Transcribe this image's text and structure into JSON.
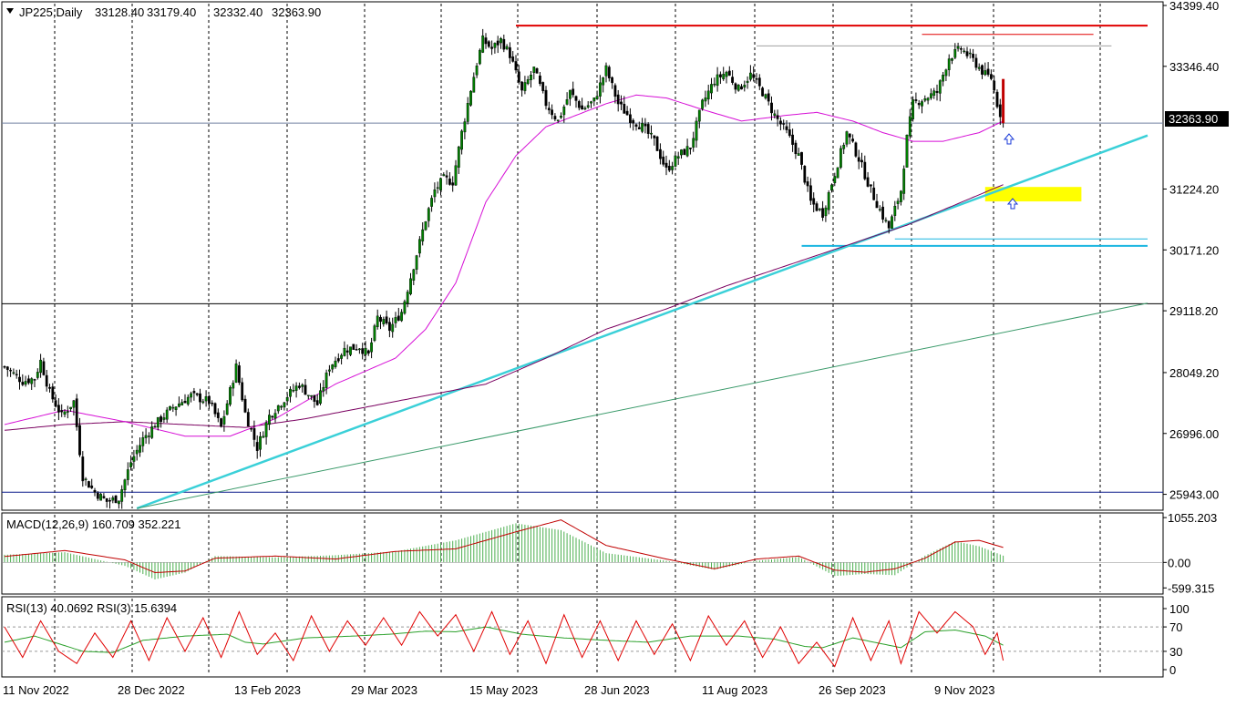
{
  "colors": {
    "bull_candle": "#008000",
    "bear_candle": "#000000",
    "ma_fast": "#d60fd6",
    "ma_slow": "#7a0060",
    "trendline": "#3ad0d8",
    "trendline_long": "#3a9a6a",
    "resistance": "#e00000",
    "support": "#19b5e0",
    "zone": "#ffff00",
    "macd_hist": "#4caf50",
    "macd_signal": "#c00000",
    "rsi_fast": "#e00000",
    "rsi_slow": "#2aa02a",
    "arrow": "#1a3ad8"
  },
  "chart_data": [
    {
      "type": "candlestick",
      "title": "JP225,Daily",
      "ohlc_readout": [
        "33128.40",
        "33179.40",
        "32332.40",
        "32363.90"
      ],
      "x_tick_labels": [
        "11 Nov 2022",
        "28 Dec 2022",
        "13 Feb 2023",
        "29 Mar 2023",
        "15 May 2023",
        "28 Jun 2023",
        "11 Aug 2023",
        "26 Sep 2023",
        "9 Nov 2023"
      ],
      "y_tick_labels": [
        "34399.40",
        "33346.40",
        "31224.20",
        "30171.20",
        "29118.20",
        "28049.20",
        "26996.00",
        "25943.00"
      ],
      "ylim": [
        25700,
        34399.4
      ],
      "current_price": "32363.90",
      "horizontal_levels": [
        34050,
        33700,
        29240,
        25980,
        30360,
        30240
      ],
      "closes_anchor": [
        [
          0,
          28150
        ],
        [
          6,
          27900
        ],
        [
          10,
          27950
        ],
        [
          12,
          28250
        ],
        [
          15,
          27700
        ],
        [
          19,
          27300
        ],
        [
          23,
          27550
        ],
        [
          26,
          26250
        ],
        [
          30,
          25980
        ],
        [
          34,
          25820
        ],
        [
          38,
          25880
        ],
        [
          42,
          26500
        ],
        [
          46,
          26900
        ],
        [
          50,
          27150
        ],
        [
          56,
          27450
        ],
        [
          62,
          27650
        ],
        [
          68,
          27550
        ],
        [
          72,
          27100
        ],
        [
          77,
          28150
        ],
        [
          80,
          27350
        ],
        [
          84,
          26750
        ],
        [
          88,
          27300
        ],
        [
          94,
          27650
        ],
        [
          98,
          27850
        ],
        [
          104,
          27500
        ],
        [
          108,
          28150
        ],
        [
          113,
          28450
        ],
        [
          118,
          28500
        ],
        [
          121,
          28350
        ],
        [
          124,
          29000
        ],
        [
          128,
          28800
        ],
        [
          132,
          29100
        ],
        [
          136,
          29900
        ],
        [
          140,
          30700
        ],
        [
          143,
          31200
        ],
        [
          146,
          31400
        ],
        [
          149,
          31350
        ],
        [
          152,
          32200
        ],
        [
          155,
          32950
        ],
        [
          157,
          33400
        ],
        [
          159,
          33800
        ],
        [
          162,
          33650
        ],
        [
          165,
          33800
        ],
        [
          168,
          33550
        ],
        [
          172,
          32900
        ],
        [
          176,
          33300
        ],
        [
          180,
          32700
        ],
        [
          184,
          32400
        ],
        [
          188,
          32900
        ],
        [
          192,
          32600
        ],
        [
          196,
          32750
        ],
        [
          200,
          33300
        ],
        [
          204,
          32700
        ],
        [
          208,
          32450
        ],
        [
          212,
          32300
        ],
        [
          216,
          32050
        ],
        [
          220,
          31550
        ],
        [
          224,
          31800
        ],
        [
          228,
          31950
        ],
        [
          232,
          32700
        ],
        [
          236,
          33100
        ],
        [
          240,
          33250
        ],
        [
          244,
          32950
        ],
        [
          248,
          33200
        ],
        [
          252,
          32900
        ],
        [
          256,
          32500
        ],
        [
          260,
          32200
        ],
        [
          264,
          31800
        ],
        [
          268,
          31000
        ],
        [
          272,
          30800
        ],
        [
          276,
          31500
        ],
        [
          280,
          32200
        ],
        [
          284,
          31750
        ],
        [
          288,
          31200
        ],
        [
          292,
          30750
        ],
        [
          294,
          30550
        ],
        [
          298,
          31200
        ],
        [
          300,
          32100
        ],
        [
          302,
          32700
        ],
        [
          306,
          32800
        ],
        [
          310,
          32900
        ],
        [
          314,
          33500
        ],
        [
          318,
          33650
        ],
        [
          322,
          33450
        ],
        [
          326,
          33200
        ],
        [
          328,
          33150
        ],
        [
          330,
          32700
        ],
        [
          332,
          32364
        ]
      ],
      "ma_fast_anchor": [
        [
          0,
          27150
        ],
        [
          20,
          27400
        ],
        [
          40,
          27200
        ],
        [
          60,
          26950
        ],
        [
          75,
          26950
        ],
        [
          90,
          27250
        ],
        [
          110,
          27850
        ],
        [
          130,
          28300
        ],
        [
          140,
          28800
        ],
        [
          150,
          29600
        ],
        [
          160,
          31000
        ],
        [
          170,
          31800
        ],
        [
          180,
          32300
        ],
        [
          190,
          32500
        ],
        [
          200,
          32700
        ],
        [
          210,
          32850
        ],
        [
          220,
          32800
        ],
        [
          232,
          32600
        ],
        [
          245,
          32400
        ],
        [
          260,
          32500
        ],
        [
          270,
          32550
        ],
        [
          282,
          32400
        ],
        [
          292,
          32200
        ],
        [
          302,
          32050
        ],
        [
          312,
          32050
        ],
        [
          324,
          32200
        ],
        [
          332,
          32400
        ]
      ],
      "ma_slow_anchor": [
        [
          0,
          27050
        ],
        [
          20,
          27150
        ],
        [
          40,
          27200
        ],
        [
          60,
          27150
        ],
        [
          80,
          27100
        ],
        [
          100,
          27250
        ],
        [
          120,
          27450
        ],
        [
          140,
          27650
        ],
        [
          160,
          27850
        ],
        [
          180,
          28300
        ],
        [
          200,
          28800
        ],
        [
          220,
          29150
        ],
        [
          240,
          29550
        ],
        [
          260,
          29900
        ],
        [
          280,
          30250
        ],
        [
          300,
          30600
        ],
        [
          316,
          30950
        ],
        [
          332,
          31300
        ]
      ],
      "trend_lines": [
        {
          "from": [
            44,
            25700
          ],
          "to": [
            380,
            32150
          ]
        },
        {
          "from": [
            44,
            25700
          ],
          "to": [
            380,
            29250
          ]
        }
      ],
      "resistance_segments": [
        {
          "value": 34050,
          "from": 170,
          "to": 380
        },
        {
          "value": 33900,
          "from": 305,
          "to": 362
        },
        {
          "value": 33700,
          "from": 250,
          "to": 368
        }
      ],
      "support_segments": [
        {
          "value": 30360,
          "from": 296,
          "to": 380
        },
        {
          "value": 30240,
          "from": 265,
          "to": 380
        }
      ],
      "zone": {
        "x_from": 326,
        "x_to": 358,
        "y_from": 31010,
        "y_to": 31260
      }
    },
    {
      "type": "bar",
      "title": "MACD(12,26,9) 160.709 352.221",
      "y_tick_labels": [
        "1055.203",
        "0.00",
        "-599.315"
      ],
      "ylim": [
        -700,
        1100
      ],
      "hist_anchor": [
        [
          0,
          180
        ],
        [
          20,
          240
        ],
        [
          40,
          -80
        ],
        [
          50,
          -400
        ],
        [
          60,
          -240
        ],
        [
          70,
          150
        ],
        [
          90,
          120
        ],
        [
          110,
          170
        ],
        [
          130,
          260
        ],
        [
          150,
          520
        ],
        [
          170,
          920
        ],
        [
          185,
          760
        ],
        [
          200,
          220
        ],
        [
          220,
          40
        ],
        [
          236,
          -170
        ],
        [
          250,
          40
        ],
        [
          264,
          130
        ],
        [
          276,
          -320
        ],
        [
          286,
          -270
        ],
        [
          296,
          -300
        ],
        [
          306,
          160
        ],
        [
          316,
          500
        ],
        [
          324,
          380
        ],
        [
          332,
          160
        ]
      ],
      "signal_anchor": [
        [
          0,
          140
        ],
        [
          20,
          280
        ],
        [
          40,
          60
        ],
        [
          50,
          -240
        ],
        [
          60,
          -200
        ],
        [
          70,
          100
        ],
        [
          90,
          150
        ],
        [
          110,
          80
        ],
        [
          130,
          260
        ],
        [
          150,
          320
        ],
        [
          170,
          720
        ],
        [
          185,
          1000
        ],
        [
          200,
          400
        ],
        [
          220,
          80
        ],
        [
          236,
          -150
        ],
        [
          250,
          80
        ],
        [
          264,
          150
        ],
        [
          276,
          -180
        ],
        [
          286,
          -230
        ],
        [
          296,
          -150
        ],
        [
          306,
          100
        ],
        [
          316,
          480
        ],
        [
          324,
          520
        ],
        [
          332,
          352
        ]
      ]
    },
    {
      "type": "line",
      "title": "RSI(13) 40.0692 RSI(3) 15.6394",
      "y_tick_labels": [
        "100",
        "70",
        "30",
        "0"
      ],
      "ylim": [
        0,
        100
      ],
      "rsi_slow_anchor": [
        [
          0,
          45
        ],
        [
          10,
          55
        ],
        [
          26,
          30
        ],
        [
          36,
          28
        ],
        [
          46,
          48
        ],
        [
          60,
          55
        ],
        [
          74,
          58
        ],
        [
          80,
          45
        ],
        [
          86,
          42
        ],
        [
          100,
          52
        ],
        [
          116,
          55
        ],
        [
          128,
          58
        ],
        [
          140,
          63
        ],
        [
          150,
          62
        ],
        [
          160,
          70
        ],
        [
          172,
          58
        ],
        [
          186,
          52
        ],
        [
          200,
          48
        ],
        [
          214,
          45
        ],
        [
          228,
          55
        ],
        [
          244,
          55
        ],
        [
          256,
          50
        ],
        [
          266,
          38
        ],
        [
          272,
          36
        ],
        [
          282,
          52
        ],
        [
          292,
          42
        ],
        [
          298,
          36
        ],
        [
          306,
          62
        ],
        [
          316,
          65
        ],
        [
          326,
          55
        ],
        [
          332,
          40
        ]
      ],
      "rsi_fast_anchor": [
        [
          0,
          70
        ],
        [
          6,
          20
        ],
        [
          12,
          80
        ],
        [
          18,
          30
        ],
        [
          24,
          10
        ],
        [
          30,
          60
        ],
        [
          36,
          20
        ],
        [
          42,
          80
        ],
        [
          48,
          15
        ],
        [
          54,
          85
        ],
        [
          60,
          30
        ],
        [
          66,
          85
        ],
        [
          72,
          20
        ],
        [
          78,
          95
        ],
        [
          84,
          25
        ],
        [
          90,
          60
        ],
        [
          96,
          15
        ],
        [
          102,
          88
        ],
        [
          108,
          30
        ],
        [
          114,
          80
        ],
        [
          120,
          40
        ],
        [
          126,
          85
        ],
        [
          132,
          40
        ],
        [
          138,
          95
        ],
        [
          144,
          55
        ],
        [
          150,
          90
        ],
        [
          156,
          30
        ],
        [
          162,
          95
        ],
        [
          168,
          25
        ],
        [
          174,
          80
        ],
        [
          180,
          10
        ],
        [
          186,
          90
        ],
        [
          192,
          20
        ],
        [
          198,
          80
        ],
        [
          204,
          15
        ],
        [
          210,
          80
        ],
        [
          216,
          25
        ],
        [
          222,
          75
        ],
        [
          228,
          15
        ],
        [
          234,
          88
        ],
        [
          240,
          40
        ],
        [
          246,
          80
        ],
        [
          252,
          20
        ],
        [
          258,
          70
        ],
        [
          264,
          10
        ],
        [
          270,
          45
        ],
        [
          276,
          5
        ],
        [
          282,
          85
        ],
        [
          288,
          15
        ],
        [
          294,
          80
        ],
        [
          298,
          10
        ],
        [
          304,
          95
        ],
        [
          310,
          60
        ],
        [
          316,
          95
        ],
        [
          322,
          70
        ],
        [
          326,
          25
        ],
        [
          330,
          60
        ],
        [
          332,
          15
        ]
      ]
    }
  ],
  "date_labels": [
    "11 Nov 2022",
    "28 Dec 2022",
    "13 Feb 2023",
    "29 Mar 2023",
    "15 May 2023",
    "28 Jun 2023",
    "11 Aug 2023",
    "26 Sep 2023",
    "9 Nov 2023"
  ]
}
